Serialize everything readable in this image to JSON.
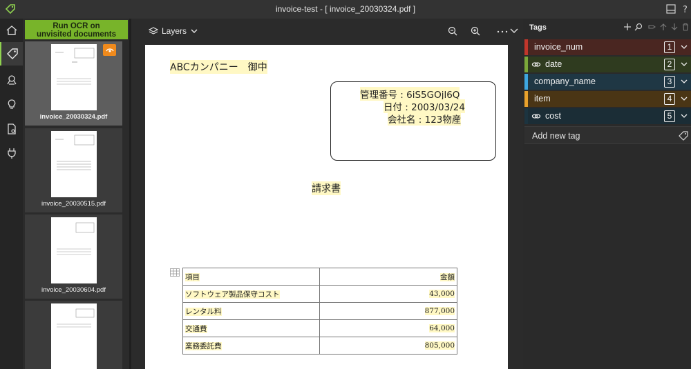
{
  "window": {
    "title": "invoice-test - [ invoice_20030324.pdf ]"
  },
  "activity_bar": {
    "items": [
      {
        "name": "home-icon"
      },
      {
        "name": "tag-icon",
        "active": true
      },
      {
        "name": "model-icon"
      },
      {
        "name": "lightbulb-icon"
      },
      {
        "name": "document-settings-icon"
      },
      {
        "name": "plug-icon"
      }
    ]
  },
  "thumbnails": {
    "ocr_button_line1": "Run OCR on",
    "ocr_button_line2": "unvisited documents",
    "files": [
      {
        "name": "invoice_20030324.pdf",
        "active": true,
        "visited": true
      },
      {
        "name": "invoice_20030515.pdf",
        "active": false
      },
      {
        "name": "invoice_20030604.pdf",
        "active": false
      },
      {
        "name": "",
        "active": false
      }
    ]
  },
  "toolbar": {
    "layers_label": "Layers"
  },
  "document": {
    "addressee": "ABCカンパニー　御中",
    "mgmt_number": "管理番号 : 6iS5GOjl6Q",
    "date": "日付 : 2003/03/24",
    "company": "会社名 : 123物産",
    "doc_title": "請求書",
    "table": {
      "headers": [
        "項目",
        "金額"
      ],
      "rows": [
        [
          "ソフトウェア製品保守コスト",
          "43,000"
        ],
        [
          "レンタル料",
          "877,000"
        ],
        [
          "交通費",
          "64,000"
        ],
        [
          "業務委託費",
          "805,000"
        ]
      ]
    }
  },
  "tags": {
    "header": "Tags",
    "items": [
      {
        "label": "invoice_num",
        "hotkey": "1",
        "color": "#c1362b",
        "bg": "#4a2621",
        "linked": false
      },
      {
        "label": "date",
        "hotkey": "2",
        "color": "#7ba83a",
        "bg": "#2f3b1f",
        "linked": true
      },
      {
        "label": "company_name",
        "hotkey": "3",
        "color": "#3ea6e0",
        "bg": "#1f3744",
        "linked": false
      },
      {
        "label": "item",
        "hotkey": "4",
        "color": "#e9a12c",
        "bg": "#4a3515",
        "linked": false
      },
      {
        "label": "cost",
        "hotkey": "5",
        "color": "#1c3440",
        "bg": "#1b2d36",
        "linked": true
      }
    ],
    "add_placeholder": "Add new tag"
  }
}
